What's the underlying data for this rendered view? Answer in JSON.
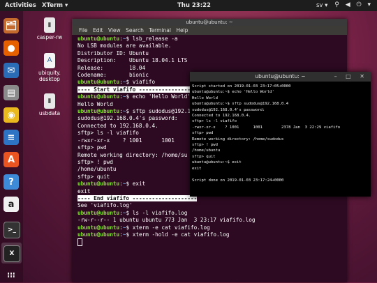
{
  "topbar": {
    "activities": "Activities",
    "app": "XTerm ▾",
    "clock": "Thu 23:22",
    "lang": "sv ▾",
    "tray": "⚲ ◀ ⏻ ▾"
  },
  "dock": [
    {
      "name": "files-icon",
      "glyph": "🗂",
      "color": "#c56a2d"
    },
    {
      "name": "firefox-icon",
      "glyph": "●",
      "color": "#e66000"
    },
    {
      "name": "thunderbird-icon",
      "glyph": "✉",
      "color": "#2a6cb6"
    },
    {
      "name": "file-manager-icon",
      "glyph": "▤",
      "color": "#8b8b8b"
    },
    {
      "name": "rhythmbox-icon",
      "glyph": "◉",
      "color": "#e9b91e"
    },
    {
      "name": "writer-icon",
      "glyph": "≡",
      "color": "#2d74c4"
    },
    {
      "name": "software-center-icon",
      "glyph": "A",
      "color": "#e95420"
    },
    {
      "name": "help-icon",
      "glyph": "?",
      "color": "#3c8ad8"
    },
    {
      "name": "amazon-icon",
      "glyph": "a",
      "color": "#f0f0f0"
    },
    {
      "name": "terminal-icon",
      "glyph": ">_",
      "color": "#333333"
    },
    {
      "name": "xterm-icon",
      "glyph": "X",
      "color": "#222222"
    },
    {
      "name": "show-apps-icon",
      "glyph": "⁝⁝⁝",
      "color": "transparent"
    }
  ],
  "desktop": {
    "casper": "casper-rw",
    "ubiquity": "ubiquity.\ndesktop",
    "usbdata": "usbdata"
  },
  "term1": {
    "title": "ubuntu@ubuntu: ~",
    "menu": [
      "File",
      "Edit",
      "View",
      "Search",
      "Terminal",
      "Help"
    ],
    "prompt": "ubuntu@ubuntu",
    "path": "~",
    "lines": {
      "l1_cmd": "$ lsb_release -a",
      "l2": "No LSB modules are available.",
      "l3": "Distributor ID: Ubuntu",
      "l4": "Description:    Ubuntu 18.04.1 LTS",
      "l5": "Release:        18.04",
      "l6": "Codename:       bionic",
      "l7_cmd": "$ viafifo",
      "l8_banner": "---- Start viafifo ------------------",
      "l9_cmd": "$ echo 'Hello World'",
      "l10": "Hello World",
      "l11_cmd": "$ sftp sudodus@192.16",
      "l12": "sudodus@192.168.0.4's password: ",
      "l13": "Connected to 192.168.0.4.",
      "l14": "sftp> ls -l viafifo",
      "l15": "-rwxr-xr-x    ? 1001      1001",
      "l16": "sftp> pwd",
      "l17": "Remote working directory: /home/su",
      "l18": "sftp> ! pwd",
      "l19": "/home/ubuntu",
      "l20": "sftp> quit",
      "l21_cmd": "$ exit",
      "l22": "exit",
      "l23_banner": "---- End viafifo --------------------",
      "l24": "See 'viafifo.log'",
      "l25_cmd": "$ ls -l viafifo.log",
      "l26": "-rw-r--r-- 1 ubuntu ubuntu 773 Jan  3 23:17 viafifo.log",
      "l27_cmd": "$ xterm -e cat viafifo.log",
      "l28_cmd": "$ xterm -hold -e cat viafifo.log"
    }
  },
  "term2": {
    "title": "ubuntu@ubuntu: ~",
    "buttons": "– □ ✕",
    "text": "Script started on 2019-01-03 23:17:05+0000\nubuntu@ubuntu:~$ echo 'Hello World'\nHello World\nubuntu@ubuntu:~$ sftp sudodus@192.168.0.4\nsudodus@192.168.0.4's password:\nConnected to 192.168.0.4.\nsftp> ls -l viafifo\n-rwxr-xr-x    ? 1001      1001        2378 Jan  3 22:29 viafifo\nsftp> pwd\nRemote working directory: /home/sudodus\nsftp> ! pwd\n/home/ubuntu\nsftp> quit\nubuntu@ubuntu:~$ exit\nexit\n\nScript done on 2019-01-03 23:17:24+0000"
  }
}
